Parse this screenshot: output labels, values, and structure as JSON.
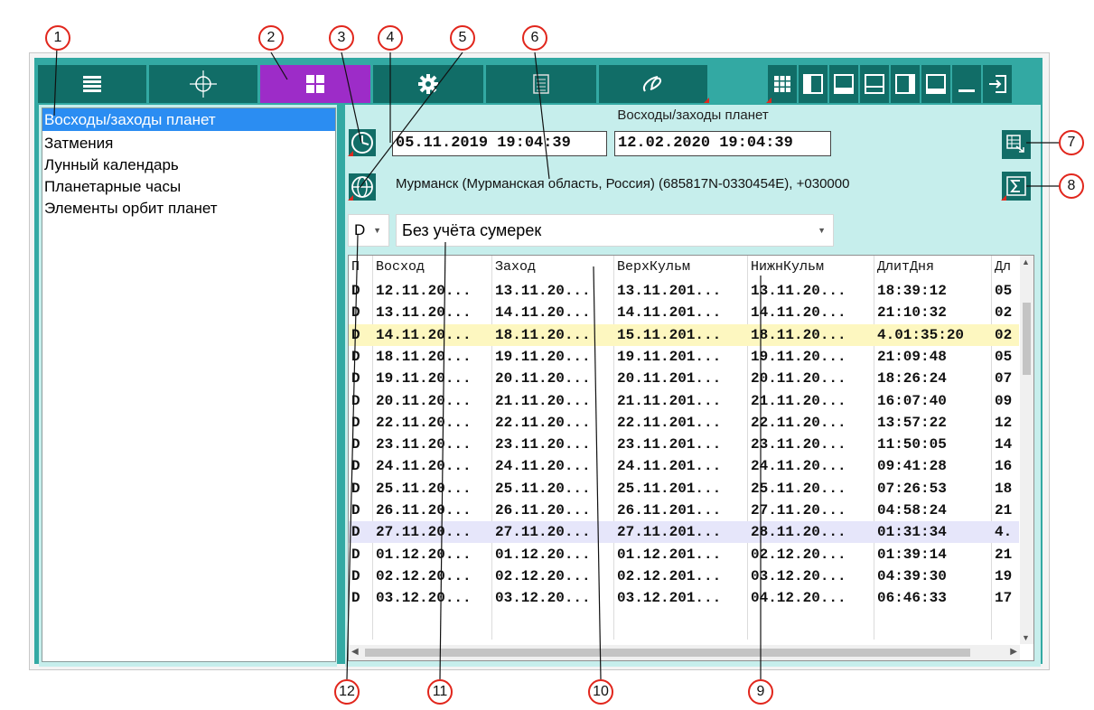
{
  "toolbar": {
    "buttons": [
      "list-icon",
      "crosshair-icon",
      "grid-icon",
      "gear-icon",
      "calculator-icon",
      "sigma-script-icon"
    ],
    "small_buttons": [
      "grid9-icon",
      "layout-left-icon",
      "layout-bottom-icon",
      "layout-split-icon",
      "layout-right-icon",
      "minimize-icon",
      "exit-icon"
    ],
    "accent": "#9d2cc8",
    "bar_color": "#116d67"
  },
  "list": {
    "items": [
      "Восходы/заходы планет",
      "Затмения",
      "Лунный календарь",
      "Планетарные часы",
      "Элементы орбит планет"
    ],
    "selected_index": 0
  },
  "panel": {
    "title": "Восходы/заходы планет",
    "start_date": "05.11.2019 19:04:39",
    "end_date": "12.02.2020 19:04:39",
    "location": "Мурманск (Мурманская область, Россия) (685817N-0330454E), +030000",
    "planet_symbol": "D",
    "twilight_option": "Без учёта сумерек"
  },
  "table": {
    "columns": [
      "П",
      "Восход",
      "Заход",
      "ВерхКульм",
      "НижнКульм",
      "ДлитДня",
      "Дл"
    ],
    "rows": [
      [
        "D",
        "12.11.20...",
        "13.11.20...",
        "13.11.201...",
        "13.11.20...",
        "18:39:12",
        "05"
      ],
      [
        "D",
        "13.11.20...",
        "14.11.20...",
        "14.11.201...",
        "14.11.20...",
        "21:10:32",
        "02"
      ],
      [
        "D",
        "14.11.20...",
        "18.11.20...",
        "15.11.201...",
        "18.11.20...",
        "4.01:35:20",
        "02"
      ],
      [
        "D",
        "18.11.20...",
        "19.11.20...",
        "19.11.201...",
        "19.11.20...",
        "21:09:48",
        "05"
      ],
      [
        "D",
        "19.11.20...",
        "20.11.20...",
        "20.11.201...",
        "20.11.20...",
        "18:26:24",
        "07"
      ],
      [
        "D",
        "20.11.20...",
        "21.11.20...",
        "21.11.201...",
        "21.11.20...",
        "16:07:40",
        "09"
      ],
      [
        "D",
        "22.11.20...",
        "22.11.20...",
        "22.11.201...",
        "22.11.20...",
        "13:57:22",
        "12"
      ],
      [
        "D",
        "23.11.20...",
        "23.11.20...",
        "23.11.201...",
        "23.11.20...",
        "11:50:05",
        "14"
      ],
      [
        "D",
        "24.11.20...",
        "24.11.20...",
        "24.11.201...",
        "24.11.20...",
        "09:41:28",
        "16"
      ],
      [
        "D",
        "25.11.20...",
        "25.11.20...",
        "25.11.201...",
        "25.11.20...",
        "07:26:53",
        "18"
      ],
      [
        "D",
        "26.11.20...",
        "26.11.20...",
        "26.11.201...",
        "27.11.20...",
        "04:58:24",
        "21"
      ],
      [
        "D",
        "27.11.20...",
        "27.11.20...",
        "27.11.201...",
        "28.11.20...",
        "01:31:34",
        "4."
      ],
      [
        "D",
        "01.12.20...",
        "01.12.20...",
        "01.12.201...",
        "02.12.20...",
        "01:39:14",
        "21"
      ],
      [
        "D",
        "02.12.20...",
        "02.12.20...",
        "02.12.201...",
        "03.12.20...",
        "04:39:30",
        "19"
      ],
      [
        "D",
        "03.12.20...",
        "03.12.20...",
        "03.12.201...",
        "04.12.20...",
        "06:46:33",
        "17"
      ]
    ],
    "highlight_rows": {
      "2": "#fdf7c0",
      "11": "#e6e6fa"
    }
  },
  "callouts": [
    "1",
    "2",
    "3",
    "4",
    "5",
    "6",
    "7",
    "8",
    "9",
    "10",
    "11",
    "12"
  ]
}
